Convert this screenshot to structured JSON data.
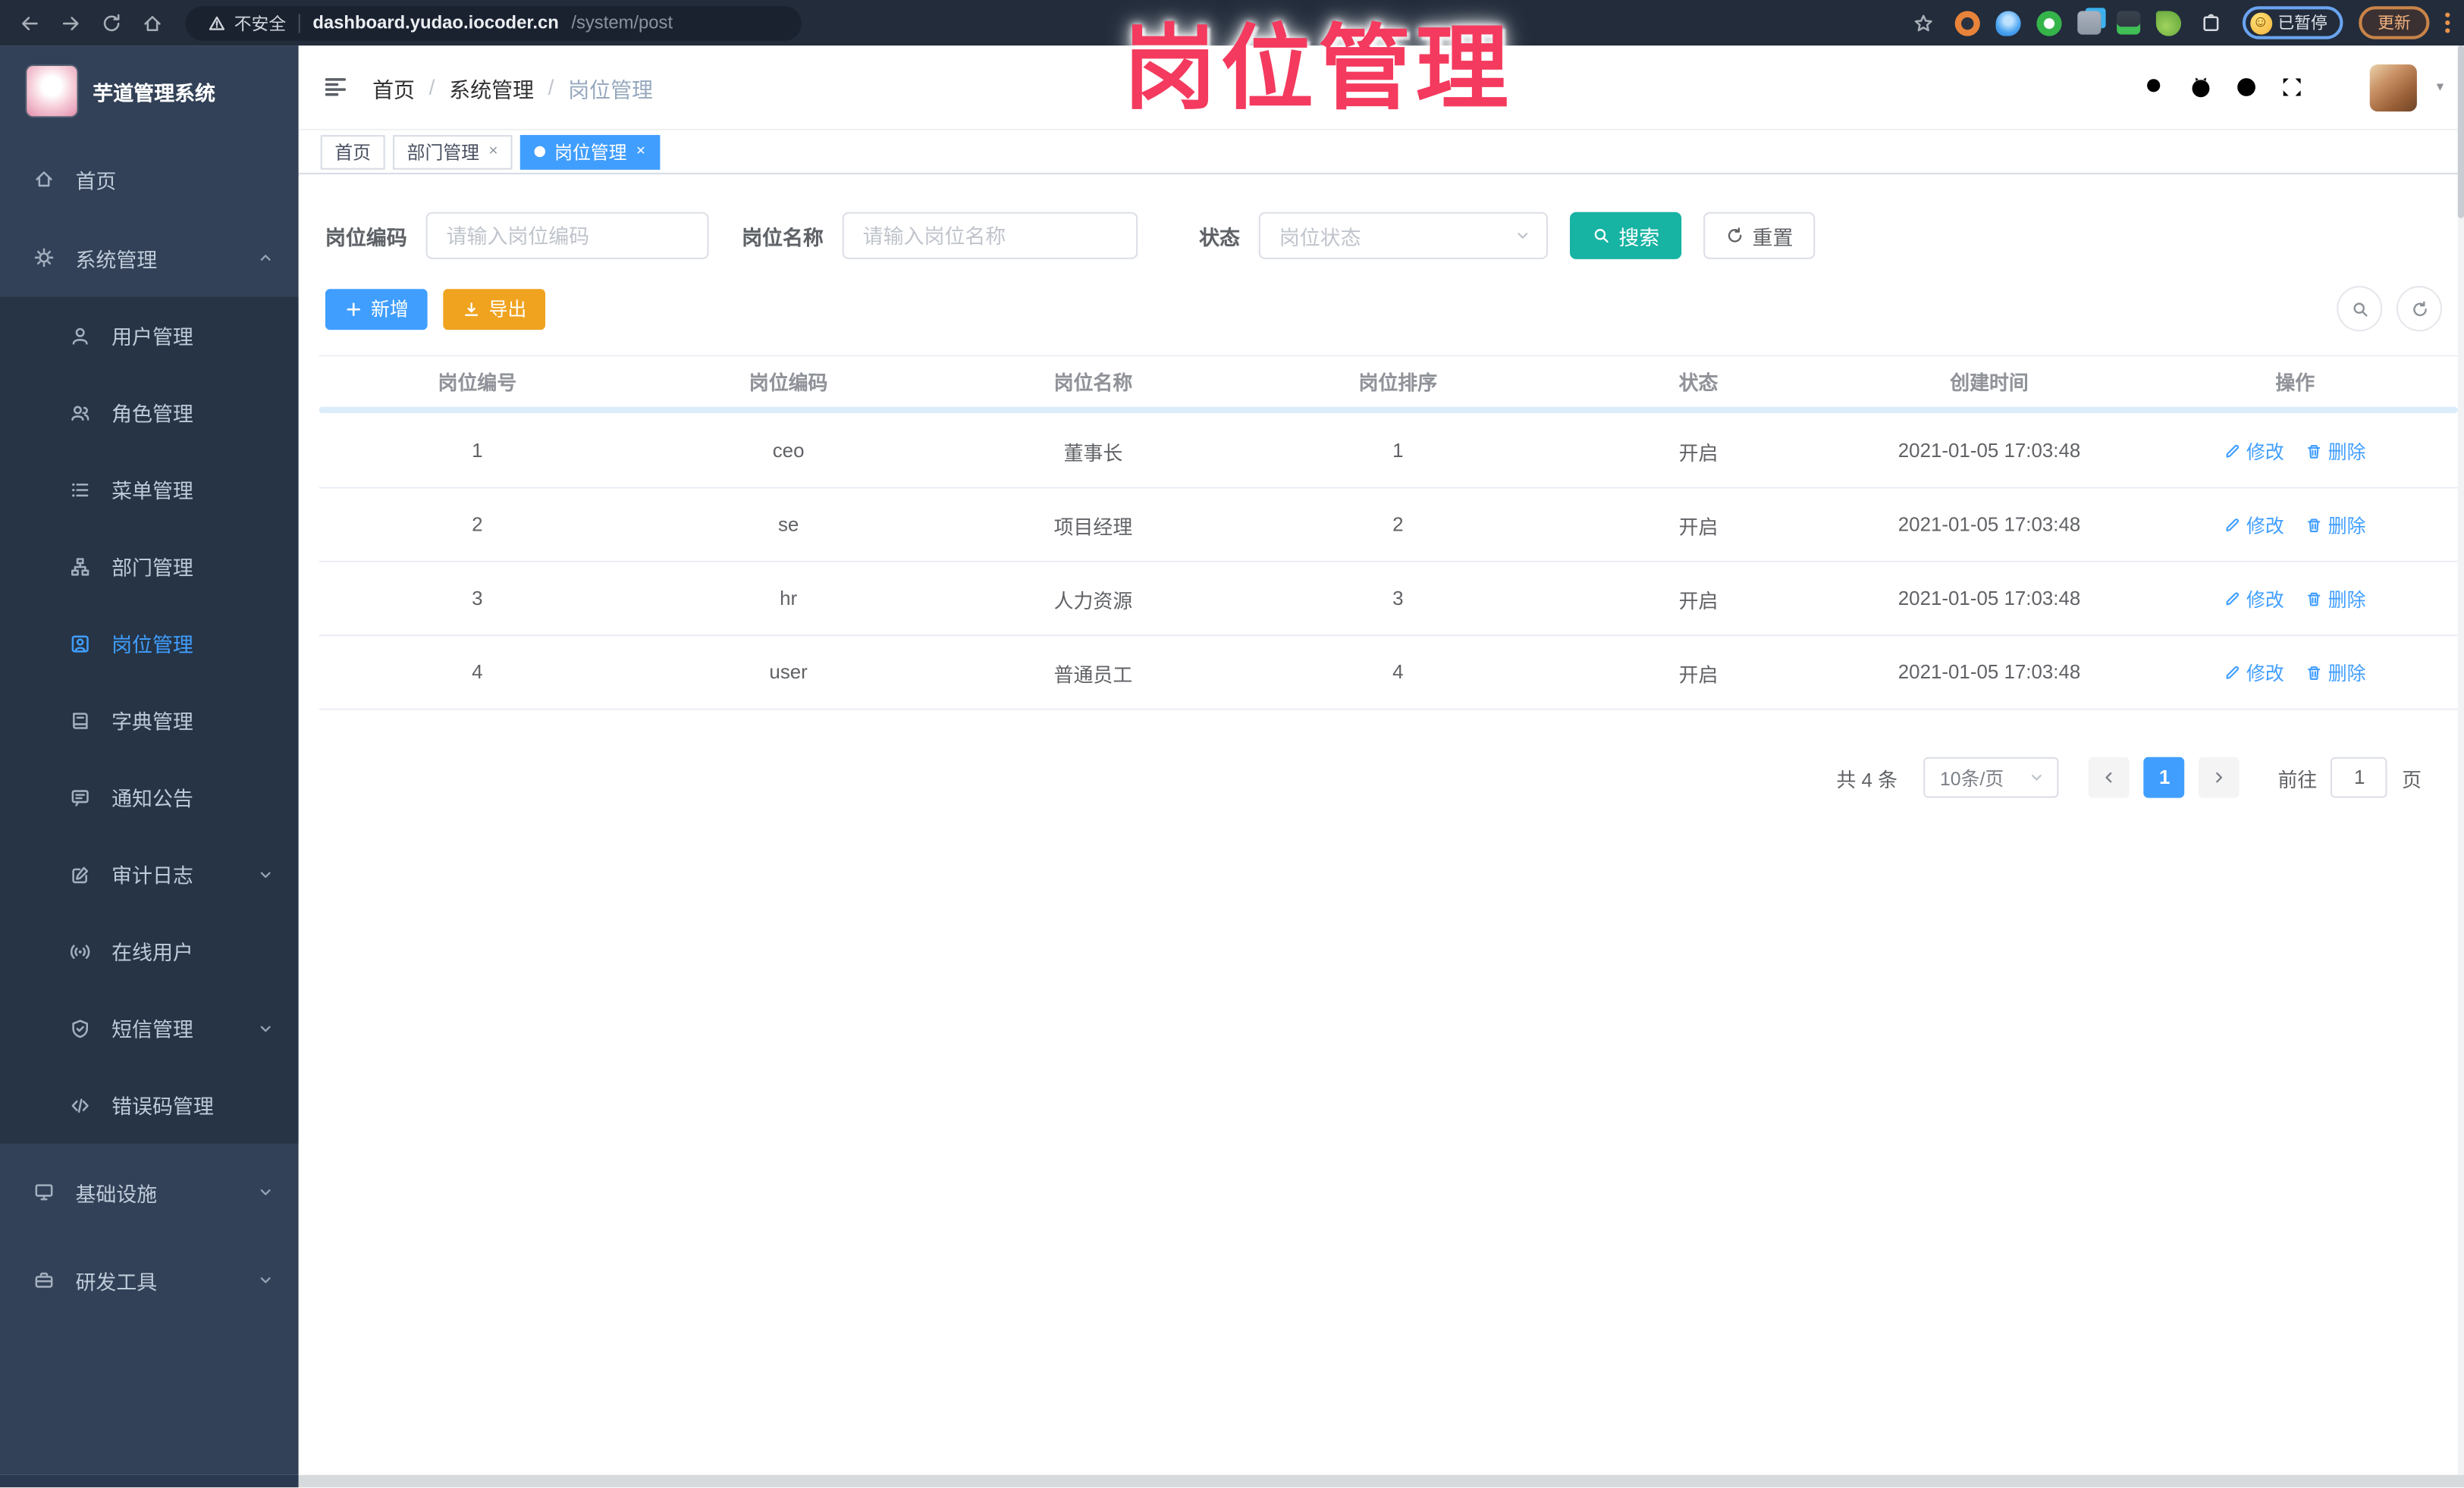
{
  "watermark": {
    "text": "岗位管理",
    "color": "#f43a5e"
  },
  "browser": {
    "security_label": "不安全",
    "url_host": "dashboard.yudao.iocoder.cn",
    "url_path": "/system/post",
    "paused_badge": "已暂停",
    "update_button": "更新",
    "smiley_glyph": "☺"
  },
  "sidebar": {
    "app_title": "芋道管理系统",
    "items": [
      {
        "label": "首页"
      },
      {
        "label": "系统管理"
      },
      {
        "label": "用户管理"
      },
      {
        "label": "角色管理"
      },
      {
        "label": "菜单管理"
      },
      {
        "label": "部门管理"
      },
      {
        "label": "岗位管理"
      },
      {
        "label": "字典管理"
      },
      {
        "label": "通知公告"
      },
      {
        "label": "审计日志"
      },
      {
        "label": "在线用户"
      },
      {
        "label": "短信管理"
      },
      {
        "label": "错误码管理"
      },
      {
        "label": "基础设施"
      },
      {
        "label": "研发工具"
      }
    ]
  },
  "header": {
    "breadcrumb": [
      "首页",
      "系统管理",
      "岗位管理"
    ],
    "separator": "/"
  },
  "tabs": [
    {
      "label": "首页"
    },
    {
      "label": "部门管理"
    },
    {
      "label": "岗位管理"
    }
  ],
  "glyphs": {
    "close": "×"
  },
  "filters": {
    "code_label": "岗位编码",
    "code_placeholder": "请输入岗位编码",
    "name_label": "岗位名称",
    "name_placeholder": "请输入岗位名称",
    "status_label": "状态",
    "status_placeholder": "岗位状态",
    "search_label": "搜索",
    "reset_label": "重置"
  },
  "toolbar": {
    "add_label": "新增",
    "export_label": "导出"
  },
  "table": {
    "columns": [
      "岗位编号",
      "岗位编码",
      "岗位名称",
      "岗位排序",
      "状态",
      "创建时间",
      "操作"
    ],
    "edit_label": "修改",
    "delete_label": "删除",
    "rows": [
      {
        "id": "1",
        "code": "ceo",
        "name": "董事长",
        "sort": "1",
        "status": "开启",
        "created_at": "2021-01-05 17:03:48"
      },
      {
        "id": "2",
        "code": "se",
        "name": "项目经理",
        "sort": "2",
        "status": "开启",
        "created_at": "2021-01-05 17:03:48"
      },
      {
        "id": "3",
        "code": "hr",
        "name": "人力资源",
        "sort": "3",
        "status": "开启",
        "created_at": "2021-01-05 17:03:48"
      },
      {
        "id": "4",
        "code": "user",
        "name": "普通员工",
        "sort": "4",
        "status": "开启",
        "created_at": "2021-01-05 17:03:48"
      }
    ]
  },
  "pagination": {
    "total": "共 4 条",
    "page_size": "10条/页",
    "current": "1",
    "goto_label": "前往",
    "goto_value": "1",
    "unit_label": "页"
  },
  "colors": {
    "primary": "#409EFF",
    "search_button": "#17b3a3",
    "export_button": "#f0a31f",
    "watermark": "#f43a5e",
    "sidebar_bg": "#324157",
    "submenu_bg": "#263445",
    "chrome_bg": "#222c3b"
  }
}
